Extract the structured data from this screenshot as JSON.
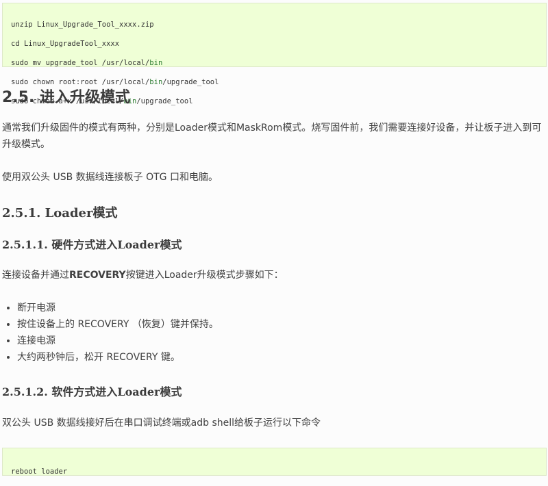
{
  "code_top": [
    "unzip Linux_Upgrade_Tool_xxxx.zip",
    "cd Linux_UpgradeTool_xxxx",
    [
      "sudo mv upgrade_tool /usr/local/",
      "bin"
    ],
    [
      "sudo chown root:root /usr/local/",
      "bin",
      "/upgrade_tool"
    ],
    [
      "sudo chmod a+x /usr/local/",
      "bin",
      "/upgrade_tool"
    ]
  ],
  "section": {
    "title": "2.5. 进入升级模式",
    "intro": "通常我们升级固件的模式有两种，分别是Loader模式和MaskRom模式。烧写固件前，我们需要连接好设备，并让板子进入到可升级模式。",
    "usb_note": "使用双公头 USB 数据线连接板子 OTG 口和电脑。"
  },
  "loader": {
    "title": "2.5.1. Loader模式",
    "hw": {
      "title": "2.5.1.1. 硬件方式进入Loader模式",
      "intro_prefix": "连接设备并通过",
      "intro_bold": "RECOVERY",
      "intro_suffix": "按键进入Loader升级模式步骤如下：",
      "steps": [
        "断开电源",
        "按住设备上的 RECOVERY （恢复）键并保持。",
        "连接电源",
        "大约两秒钟后，松开 RECOVERY 键。"
      ]
    },
    "sw": {
      "title": "2.5.1.2. 软件方式进入Loader模式",
      "intro": "双公头 USB 数据线接好后在串口调试终端或adb shell给板子运行以下命令",
      "code": "reboot loader"
    }
  }
}
